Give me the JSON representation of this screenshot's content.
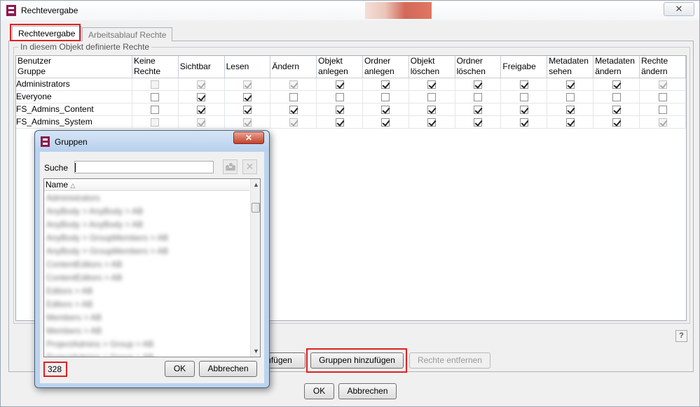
{
  "window": {
    "title": "Rechtevergabe",
    "close_symbol": "✕"
  },
  "tabs": [
    {
      "label": "Rechtevergabe",
      "active": true
    },
    {
      "label": "Arbeitsablauf Rechte",
      "active": false
    }
  ],
  "group_legend": "In diesem Objekt definierte Rechte",
  "table": {
    "columns": [
      "Benutzer\nGruppe",
      "Keine\nRechte",
      "Sichtbar",
      "Lesen",
      "Ändern",
      "Objekt\nanlegen",
      "Ordner\nanlegen",
      "Objekt\nlöschen",
      "Ordner\nlöschen",
      "Freigabe",
      "Metadaten\nsehen",
      "Metadaten\nändern",
      "Rechte\nändern"
    ],
    "rows": [
      {
        "name": "Administrators",
        "checked": [
          false,
          true,
          true,
          true,
          true,
          true,
          true,
          true,
          true,
          true,
          true,
          true
        ],
        "disabled": [
          true,
          true,
          true,
          true,
          false,
          false,
          false,
          false,
          false,
          false,
          false,
          true
        ]
      },
      {
        "name": "Everyone",
        "checked": [
          false,
          true,
          true,
          false,
          false,
          false,
          false,
          false,
          false,
          false,
          false,
          false
        ],
        "disabled": [
          false,
          false,
          false,
          false,
          false,
          false,
          false,
          false,
          false,
          false,
          false,
          false
        ]
      },
      {
        "name": "FS_Admins_Content",
        "checked": [
          false,
          true,
          true,
          true,
          true,
          true,
          true,
          true,
          true,
          true,
          true,
          false
        ],
        "disabled": [
          false,
          false,
          false,
          false,
          false,
          false,
          false,
          false,
          false,
          false,
          false,
          false
        ]
      },
      {
        "name": "FS_Admins_System",
        "checked": [
          false,
          true,
          true,
          true,
          true,
          true,
          true,
          true,
          true,
          true,
          true,
          true
        ],
        "disabled": [
          true,
          true,
          true,
          true,
          false,
          false,
          false,
          false,
          false,
          false,
          false,
          true
        ]
      }
    ]
  },
  "buttons": {
    "users_add_partial": "ufügen",
    "groups_add": "Gruppen hinzufügen",
    "rights_remove": "Rechte entfernen",
    "ok": "OK",
    "cancel": "Abbrechen",
    "help": "?"
  },
  "dialog": {
    "title": "Gruppen",
    "close_symbol": "✕",
    "search_label": "Suche",
    "search_value": "",
    "list_header": "Name",
    "sort_indicator": "△",
    "blurred_items": [
      "Administrators",
      "AnyBody > AnyBody > AB",
      "AnyBody > AnyBody > AB",
      "AnyBody > GroupMembers > AB",
      "AnyBody > GroupMembers > AB",
      "ContentEditors > AB",
      "ContentEditors > AB",
      "Editors > AB",
      "Editors > AB",
      "Members > AB",
      "Members > AB",
      "ProjectAdmins > Group > AB",
      "ProjectAdmins > Group > AB",
      "ProjectUsers > AB"
    ],
    "count": "328",
    "ok": "OK",
    "cancel": "Abbrechen"
  },
  "colors": {
    "highlight": "#e02020",
    "app_icon": "#8c1a4f",
    "dialog_frame": "#bcd3ee"
  }
}
